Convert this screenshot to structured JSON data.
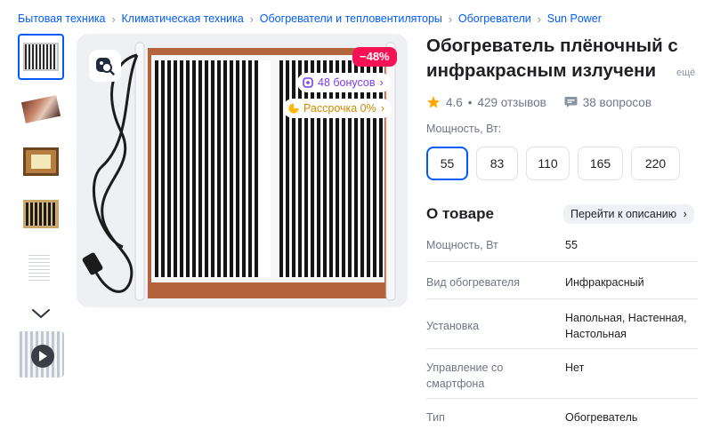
{
  "breadcrumbs": [
    "Бытовая техника",
    "Климатическая техника",
    "Обогреватели и тепловентиляторы",
    "Обогреватели",
    "Sun Power"
  ],
  "product": {
    "title_line1": "Обогреватель плёночный с",
    "title_line2": "инфракрасным излучени",
    "title_more": "ещё",
    "rating": "4.6",
    "reviews": "429 отзывов",
    "questions": "38 вопросов"
  },
  "gallery": {
    "discount_badge": "−48%",
    "bonus_badge": "48 бонусов",
    "installment_badge": "Рассрочка 0%"
  },
  "power": {
    "label": "Мощность, Вт:",
    "options": [
      "55",
      "83",
      "110",
      "165",
      "220"
    ],
    "selected": "55"
  },
  "about": {
    "title": "О товаре",
    "link_label": "Перейти к описанию"
  },
  "specs": [
    {
      "key": "Мощность, Вт",
      "value": "55"
    },
    {
      "key": "Вид обогревателя",
      "value": "Инфракрасный"
    },
    {
      "key": "Установка",
      "value": "Напольная, Настенная, Настольная"
    },
    {
      "key": "Управление со смартфона",
      "value": "Нет"
    },
    {
      "key": "Тип",
      "value": "Обогреватель"
    }
  ],
  "colors": {
    "accent": "#005bff",
    "discount": "#f91155",
    "bonus": "#7d3cf2",
    "installment": "#ce8a00",
    "star": "#ffa800"
  },
  "icons": {
    "zoom": "image-search-icon",
    "bonus": "bonus-coin-icon",
    "installment": "pie-icon",
    "star": "star-icon",
    "questions": "chat-icon",
    "thumbs_down": "chevron-down-icon",
    "video": "play-icon",
    "separator": "chevron-right-icon"
  }
}
